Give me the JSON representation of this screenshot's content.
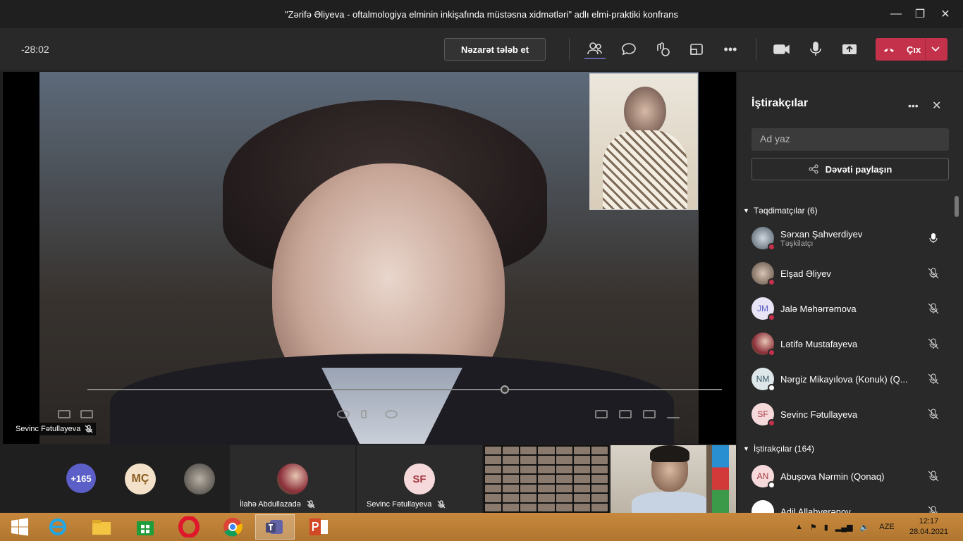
{
  "window": {
    "title": "\"Zərifə Əliyeva - oftalmologiya elminin inkişafında müstəsna xidmətləri\" adlı elmi-praktiki konfrans"
  },
  "toolbar": {
    "timer": "-28:02",
    "control_label": "Nəzarət tələb et",
    "leave_label": "Çıx"
  },
  "stage": {
    "speaker_name": "Sevinc Fətullayeva"
  },
  "strip": {
    "overflow_count": "+165",
    "avatar_initials": "MÇ",
    "tile1_name": "İlahə Abdullazadə",
    "tile2_initials": "SF",
    "tile2_name": "Sevinc Fətullayeva"
  },
  "panel": {
    "title": "İştirakçılar",
    "search_placeholder": "Ad yaz",
    "share_label": "Dəvəti paylaşın",
    "presenters_label": "Təqdimatçılar (6)",
    "attendees_label": "İştirakçılar (164)",
    "presenters": [
      {
        "initials": "",
        "name": "Sərxan Şahverdiyev",
        "role": "Təşkilatçı"
      },
      {
        "initials": "",
        "name": "Elşad Əliyev",
        "role": ""
      },
      {
        "initials": "JM",
        "name": "Jalə Məhərrəmova",
        "role": ""
      },
      {
        "initials": "",
        "name": "Lətifə Mustafayeva",
        "role": ""
      },
      {
        "initials": "NM",
        "name": "Nərgiz Mikayılova (Konuk) (Q...",
        "role": ""
      },
      {
        "initials": "SF",
        "name": "Sevinc Fətullayeva",
        "role": ""
      }
    ],
    "attendees": [
      {
        "initials": "AN",
        "name": "Abuşova Nərmin (Qonaq)"
      },
      {
        "initials": "",
        "name": "Adil Allahverənov"
      }
    ]
  },
  "taskbar": {
    "language": "AZE",
    "time": "12:17",
    "date": "28.04.2021"
  },
  "colors": {
    "accent": "#6264a7",
    "leave": "#c4314b",
    "busy": "#c4314b",
    "taskbar": "#b8802f"
  }
}
